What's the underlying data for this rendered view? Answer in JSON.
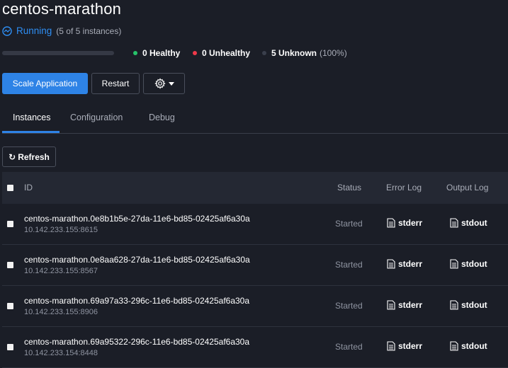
{
  "app": {
    "title": "centos-marathon",
    "status": "Running",
    "status_detail": "(5 of 5 instances)",
    "progress_fraction": 0.0
  },
  "health": {
    "healthy": "0 Healthy",
    "unhealthy": "0 Unhealthy",
    "unknown": "5 Unknown",
    "unknown_pct": "(100%)",
    "colors": {
      "healthy": "#27c36a",
      "unhealthy": "#f0394a",
      "unknown": "#3a3f4c"
    }
  },
  "toolbar": {
    "scale_label": "Scale Application",
    "restart_label": "Restart",
    "gear_icon": "gear-icon"
  },
  "tabs": [
    {
      "label": "Instances",
      "active": true
    },
    {
      "label": "Configuration",
      "active": false
    },
    {
      "label": "Debug",
      "active": false
    }
  ],
  "refresh": {
    "symbol": "↻",
    "label": "Refresh"
  },
  "table": {
    "headers": {
      "id": "ID",
      "status": "Status",
      "error_log": "Error Log",
      "output_log": "Output Log"
    },
    "rows": [
      {
        "id": "centos-marathon.0e8b1b5e-27da-11e6-bd85-02425af6a30a",
        "ip": "10.142.233.155:8615",
        "status": "Started",
        "stderr": "stderr",
        "stdout": "stdout"
      },
      {
        "id": "centos-marathon.0e8aa628-27da-11e6-bd85-02425af6a30a",
        "ip": "10.142.233.155:8567",
        "status": "Started",
        "stderr": "stderr",
        "stdout": "stdout"
      },
      {
        "id": "centos-marathon.69a97a33-296c-11e6-bd85-02425af6a30a",
        "ip": "10.142.233.155:8906",
        "status": "Started",
        "stderr": "stderr",
        "stdout": "stdout"
      },
      {
        "id": "centos-marathon.69a95322-296c-11e6-bd85-02425af6a30a",
        "ip": "10.142.233.154:8448",
        "status": "Started",
        "stderr": "stderr",
        "stdout": "stdout"
      }
    ]
  },
  "colors": {
    "accent": "#2e83e6",
    "background": "#1b1e27"
  }
}
